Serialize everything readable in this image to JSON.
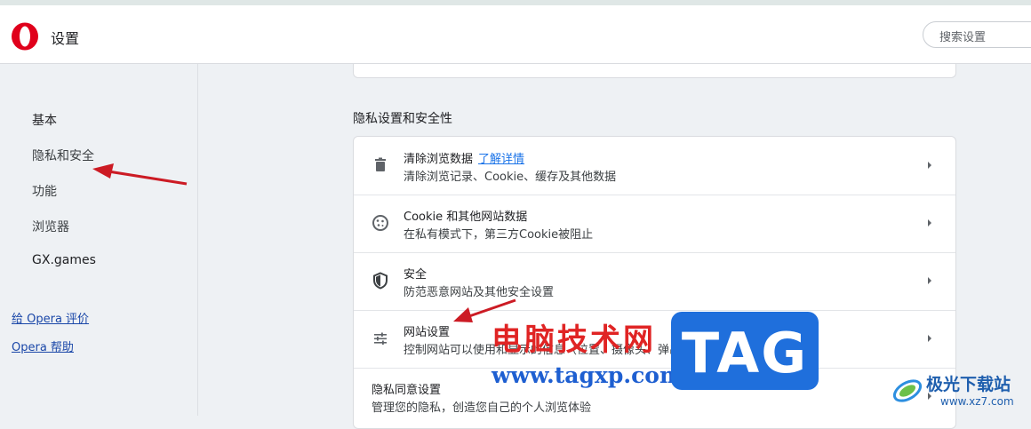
{
  "header": {
    "title": "设置",
    "search_placeholder": "搜索设置"
  },
  "sidebar": {
    "items": [
      {
        "label": "基本"
      },
      {
        "label": "隐私和安全"
      },
      {
        "label": "功能"
      },
      {
        "label": "浏览器"
      },
      {
        "label": "GX.games"
      }
    ],
    "links": [
      {
        "label": "给 Opera 评价"
      },
      {
        "label": "Opera 帮助"
      }
    ]
  },
  "main": {
    "section_title": "隐私设置和安全性",
    "rows": [
      {
        "title": "清除浏览数据",
        "link": "了解详情",
        "subtitle": "清除浏览记录、Cookie、缓存及其他数据",
        "icon": "trash-icon"
      },
      {
        "title": "Cookie 和其他网站数据",
        "subtitle": "在私有模式下，第三方Cookie被阻止",
        "icon": "cookie-icon"
      },
      {
        "title": "安全",
        "subtitle": "防范恶意网站及其他安全设置",
        "icon": "shield-icon"
      },
      {
        "title": "网站设置",
        "subtitle": "控制网站可以使用和显示的信息（位置、摄像头、弹出窗口等）",
        "icon": "sliders-icon"
      },
      {
        "title": "隐私同意设置",
        "subtitle": "管理您的隐私，创造您自己的个人浏览体验"
      }
    ]
  },
  "watermark": {
    "cn_text": "电脑技术网",
    "url": "www.tagxp.com",
    "badge": "TAG",
    "site2_name": "极光下载站",
    "site2_url": "www.xz7.com"
  },
  "colors": {
    "accent_red": "#cc1b24",
    "link_blue": "#1a73e8",
    "opera_red": "#e0001b"
  }
}
